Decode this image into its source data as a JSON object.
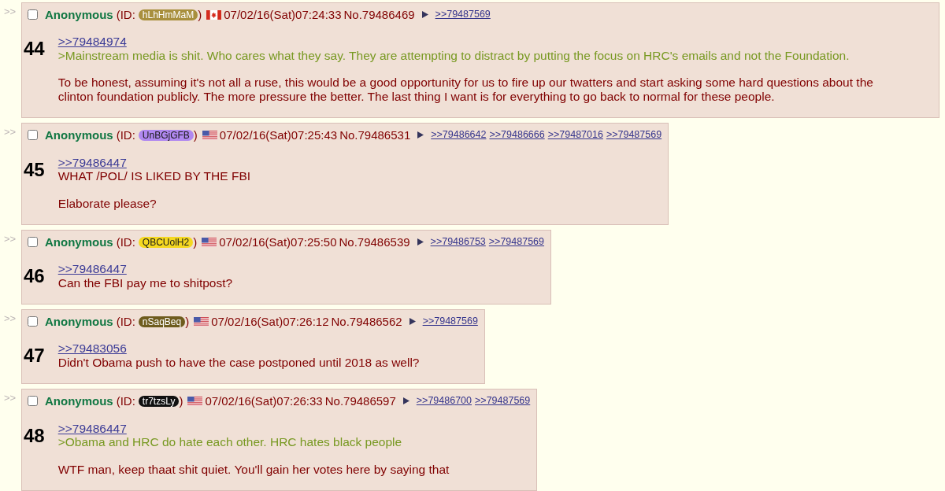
{
  "posts": [
    {
      "side_arrows": ">>",
      "checked": false,
      "name": "Anonymous",
      "id_label": "(ID:",
      "id": {
        "text": "hLhHmMaM",
        "color": "#a88f3d"
      },
      "id_close": ")",
      "kind": "ca",
      "datetime": "07/02/16(Sat)07:24:33",
      "post_no": "No.79486469",
      "backlinks": [
        ">>79487569"
      ],
      "number": "44",
      "message": [
        [
          {
            "kind": "quotelink",
            "text": ">>79484974"
          },
          {
            "kind": "greentext",
            "text": ">Mainstream media is shit. Who cares what they say. They are attempting to distract by putting the focus on HRC's emails and not the Foundation."
          }
        ],
        [
          {
            "kind": "text",
            "text": "To be honest, assuming it's not all a ruse, this would be a good opportunity for us to fire up our twatters and start asking some hard questions about the clinton foundation publicly. The more pressure the better. The last thing I want is for everything to go back to normal for these people."
          }
        ]
      ]
    },
    {
      "side_arrows": ">>",
      "checked": false,
      "name": "Anonymous",
      "id_label": "(ID:",
      "id": {
        "text": "UnBGjGFB",
        "color": "#b088f0"
      },
      "id_close": ")",
      "kind": "us",
      "datetime": "07/02/16(Sat)07:25:43",
      "post_no": "No.79486531",
      "backlinks": [
        ">>79486642",
        ">>79486666",
        ">>79487016",
        ">>79487569"
      ],
      "number": "45",
      "message": [
        [
          {
            "kind": "quotelink",
            "text": ">>79486447"
          },
          {
            "kind": "text",
            "text": "WHAT /POL/ IS LIKED BY THE FBI"
          }
        ],
        [
          {
            "kind": "text",
            "text": "Elaborate please?"
          }
        ]
      ]
    },
    {
      "side_arrows": ">>",
      "checked": false,
      "name": "Anonymous",
      "id_label": "(ID:",
      "id": {
        "text": "QBCUolH2",
        "color": "#f5d820"
      },
      "id_close": ")",
      "kind": "us",
      "datetime": "07/02/16(Sat)07:25:50",
      "post_no": "No.79486539",
      "backlinks": [
        ">>79486753",
        ">>79487569"
      ],
      "number": "46",
      "message": [
        [
          {
            "kind": "quotelink",
            "text": ">>79486447"
          },
          {
            "kind": "text",
            "text": "Can the FBI pay me to shitpost?"
          }
        ]
      ]
    },
    {
      "side_arrows": ">>",
      "checked": false,
      "name": "Anonymous",
      "id_label": "(ID:",
      "id": {
        "text": "nSaqBeq",
        "color": "#6e5c1e"
      },
      "id_close": ")",
      "kind": "us",
      "datetime": "07/02/16(Sat)07:26:12",
      "post_no": "No.79486562",
      "backlinks": [
        ">>79487569"
      ],
      "number": "47",
      "message": [
        [
          {
            "kind": "quotelink",
            "text": ">>79483056"
          },
          {
            "kind": "text",
            "text": "Didn't Obama push to have the case postponed until 2018 as well?"
          }
        ]
      ]
    },
    {
      "side_arrows": ">>",
      "checked": false,
      "name": "Anonymous",
      "id_label": "(ID:",
      "id": {
        "text": "tr7tzsLy",
        "color": "#111111"
      },
      "id_close": ")",
      "kind": "us",
      "datetime": "07/02/16(Sat)07:26:33",
      "post_no": "No.79486597",
      "backlinks": [
        ">>79486700",
        ">>79487569"
      ],
      "number": "48",
      "message": [
        [
          {
            "kind": "quotelink",
            "text": ">>79486447"
          },
          {
            "kind": "greentext",
            "text": ">Obama and HRC do hate each other. HRC hates black people"
          }
        ],
        [
          {
            "kind": "text",
            "text": "WTF man, keep thaat shit quiet. You'll gain her votes here by saying that"
          }
        ]
      ]
    }
  ]
}
